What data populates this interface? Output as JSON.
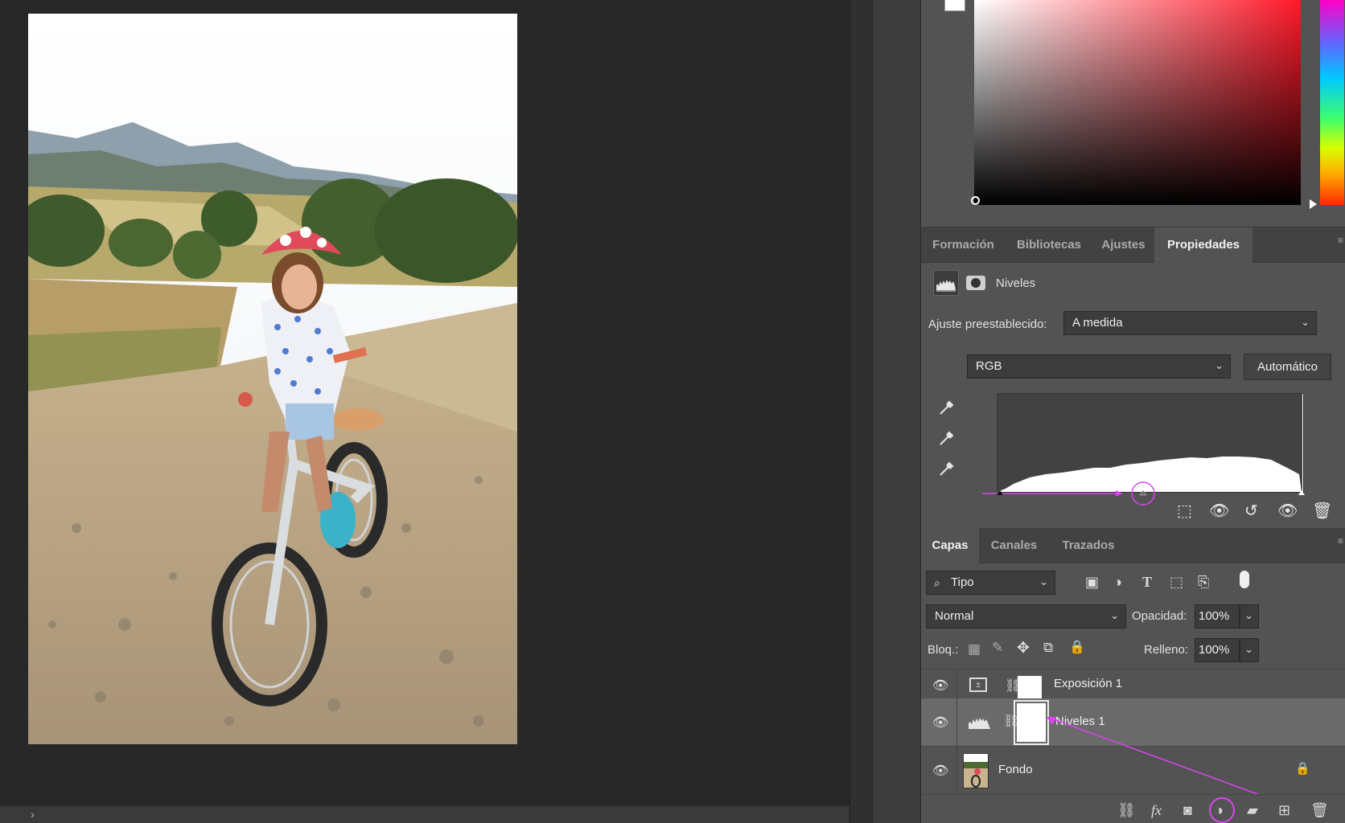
{
  "colors": {
    "accent": "#d946ef",
    "panel_bg": "#535353"
  },
  "properties_tabs": [
    {
      "label": "Formación",
      "active": false
    },
    {
      "label": "Bibliotecas",
      "active": false
    },
    {
      "label": "Ajustes",
      "active": false
    },
    {
      "label": "Propiedades",
      "active": true
    }
  ],
  "properties": {
    "adjustment_title": "Niveles",
    "preset_label": "Ajuste preestablecido:",
    "preset_value": "A medida",
    "channel_value": "RGB",
    "auto_button": "Automático"
  },
  "layers_tabs": [
    {
      "label": "Capas",
      "active": true
    },
    {
      "label": "Canales",
      "active": false
    },
    {
      "label": "Trazados",
      "active": false
    }
  ],
  "layers": {
    "filter_value": "Tipo",
    "blend_mode": "Normal",
    "opacity_label": "Opacidad:",
    "opacity_value": "100%",
    "lock_label": "Bloq.:",
    "fill_label": "Relleno:",
    "fill_value": "100%",
    "items": [
      {
        "name": "Exposición 1",
        "visible": true,
        "selected": false
      },
      {
        "name": "Niveles 1",
        "visible": true,
        "selected": true
      },
      {
        "name": "Fondo",
        "visible": true,
        "selected": false,
        "locked": true
      }
    ]
  },
  "icons": {
    "eye": "👁",
    "lock": "🔒",
    "trash": "🗑",
    "status_chevron": "›",
    "dropdown": "⌄"
  }
}
